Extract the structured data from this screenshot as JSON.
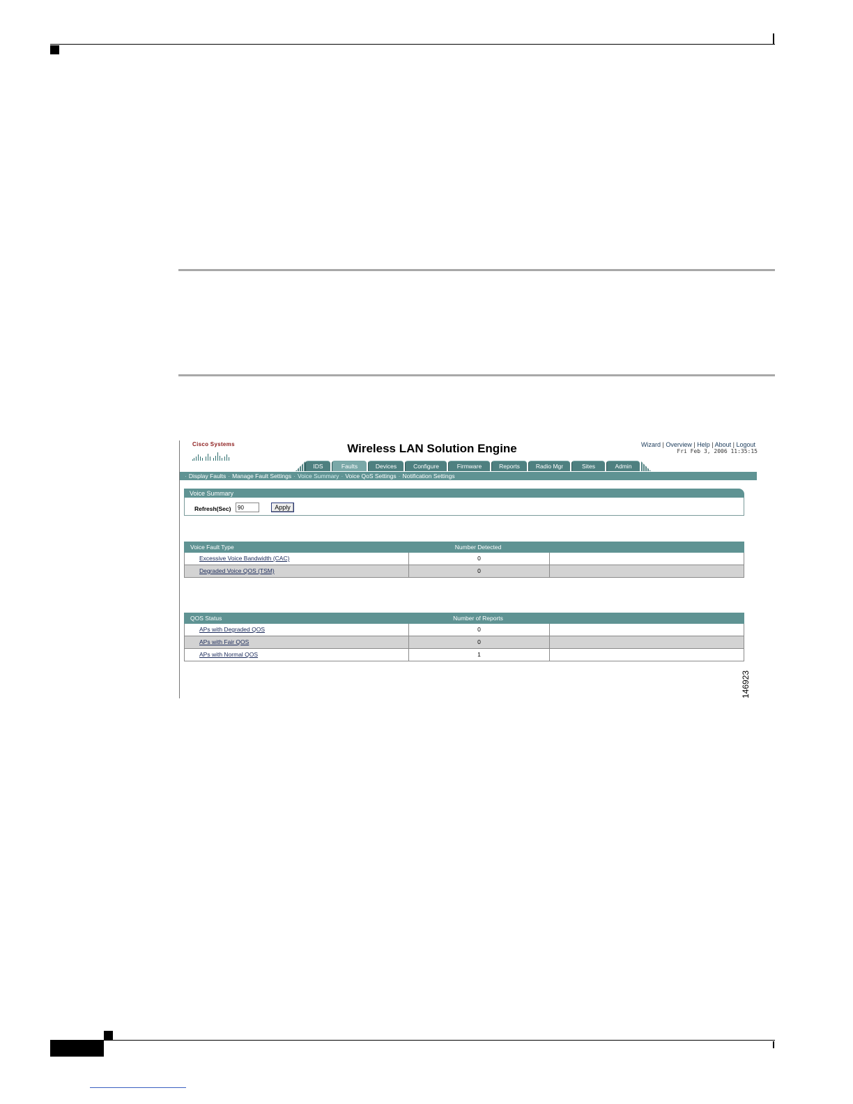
{
  "app": {
    "logo_text": "Cisco Systems",
    "title": "Wireless LAN Solution Engine",
    "links": [
      "Wizard",
      "Overview",
      "Help",
      "About",
      "Logout"
    ],
    "datetime": "Fri Feb 3, 2006 11:35:15"
  },
  "tabs": [
    {
      "label": "IDS",
      "active": false
    },
    {
      "label": "Faults",
      "active": true
    },
    {
      "label": "Devices",
      "active": false
    },
    {
      "label": "Configure",
      "active": false
    },
    {
      "label": "Firmware",
      "active": false
    },
    {
      "label": "Reports",
      "active": false
    },
    {
      "label": "Radio Mgr",
      "active": false
    },
    {
      "label": "Sites",
      "active": false
    },
    {
      "label": "Admin",
      "active": false
    }
  ],
  "subnav": [
    {
      "label": "Display Faults",
      "active": false
    },
    {
      "label": "Manage Fault Settings",
      "active": false
    },
    {
      "label": "Voice Summary",
      "active": true
    },
    {
      "label": "Voice QoS Settings",
      "active": false
    },
    {
      "label": "Notification Settings",
      "active": false
    }
  ],
  "voice_summary": {
    "title": "Voice Summary",
    "refresh_label": "Refresh(Sec)",
    "refresh_value": "90",
    "apply_label": "Apply"
  },
  "fault_table": {
    "headers": [
      "Voice Fault Type",
      "Number Detected"
    ],
    "rows": [
      {
        "type": "Excessive Voice Bandwidth (CAC)",
        "count": "0"
      },
      {
        "type": "Degraded Voice QOS (TSM)",
        "count": "0"
      }
    ]
  },
  "qos_table": {
    "headers": [
      "QOS Status",
      "Number of Reports"
    ],
    "rows": [
      {
        "status": "APs with Degraded QOS",
        "count": "0"
      },
      {
        "status": "APs with Fair QOS",
        "count": "0"
      },
      {
        "status": "APs with Normal QOS",
        "count": "1"
      }
    ]
  },
  "figure_id": "146923",
  "colors": {
    "teal_header": "#5f9393",
    "tab_bg": "#4e8080",
    "alt_row": "#d3d3d3"
  }
}
